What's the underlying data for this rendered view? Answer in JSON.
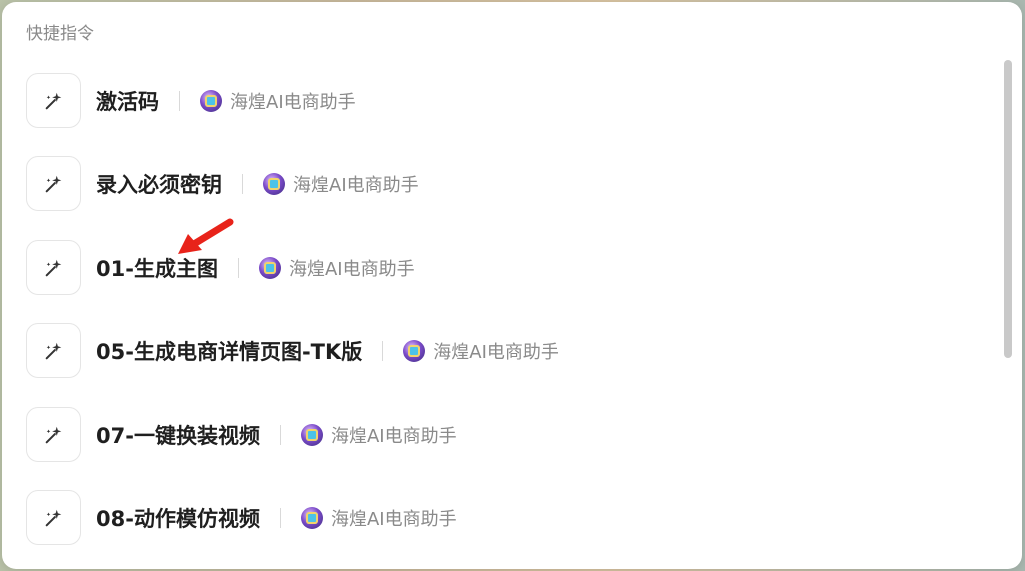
{
  "panel": {
    "title": "快捷指令"
  },
  "items": [
    {
      "title": "激活码",
      "app": "海煌AI电商助手"
    },
    {
      "title": "录入必须密钥",
      "app": "海煌AI电商助手"
    },
    {
      "title": "01-生成主图",
      "app": "海煌AI电商助手"
    },
    {
      "title": "05-生成电商详情页图-TK版",
      "app": "海煌AI电商助手"
    },
    {
      "title": "07-一键换装视频",
      "app": "海煌AI电商助手"
    },
    {
      "title": "08-动作模仿视频",
      "app": "海煌AI电商助手"
    }
  ],
  "icons": {
    "item_icon": "sparkle-wand-icon",
    "app_icon": "app-avatar-icon"
  },
  "colors": {
    "annotation_arrow": "#e8231a"
  }
}
